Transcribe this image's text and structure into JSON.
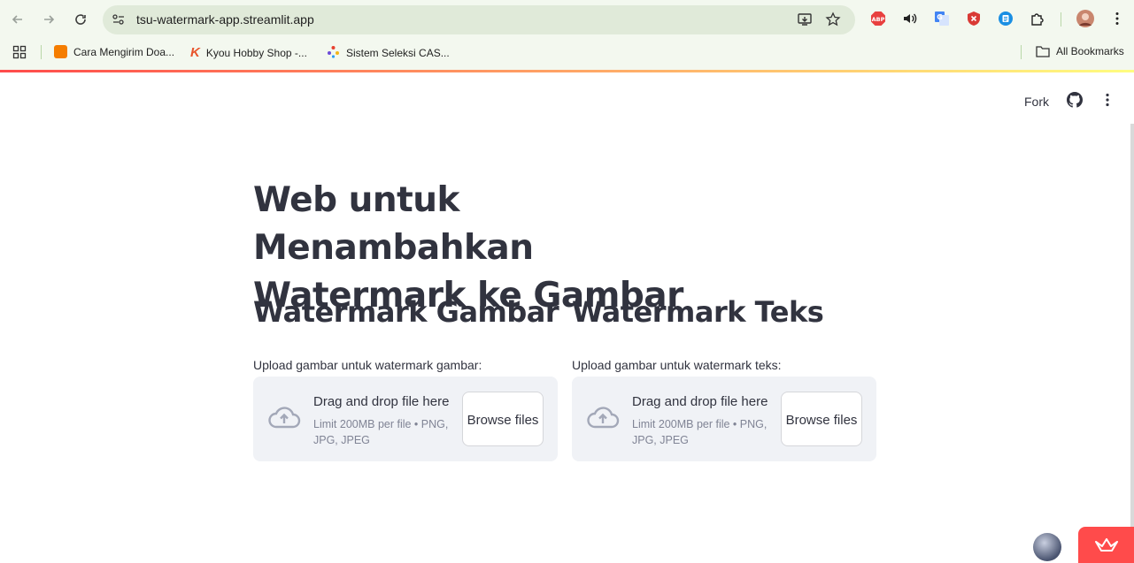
{
  "browser": {
    "url": "tsu-watermark-app.streamlit.app",
    "bookmarks": [
      {
        "label": "Cara Mengirim Doa...",
        "icon": "blogger-icon",
        "color": "#f57d00"
      },
      {
        "label": "Kyou Hobby Shop -...",
        "icon": "kyou-icon",
        "color": "#e8542c"
      },
      {
        "label": "Sistem Seleksi CAS...",
        "icon": "sparkle-icon",
        "color": "#6b4bd8"
      }
    ],
    "all_bookmarks": "All Bookmarks",
    "extensions": [
      "abp-icon",
      "audio-icon",
      "translate-icon",
      "shield-icon",
      "reader-icon",
      "puzzle-icon",
      "profile-avatar",
      "more-icon"
    ]
  },
  "toolbar": {
    "fork": "Fork"
  },
  "page": {
    "title": "Web untuk Menambahkan Watermark ke Gambar",
    "columns": [
      {
        "heading": "Watermark Gambar",
        "label": "Upload gambar untuk watermark gambar:",
        "dz_title": "Drag and drop file here",
        "dz_limit": "Limit 200MB per file • PNG, JPG, JPEG",
        "browse": "Browse files"
      },
      {
        "heading": "Watermark Teks",
        "label": "Upload gambar untuk watermark teks:",
        "dz_title": "Drag and drop file here",
        "dz_limit": "Limit 200MB per file • PNG, JPG, JPEG",
        "browse": "Browse files"
      }
    ]
  },
  "colors": {
    "accent": "#ff4b4b",
    "text": "#31333f",
    "dropzone_bg": "#f0f2f6",
    "muted": "#808495"
  }
}
